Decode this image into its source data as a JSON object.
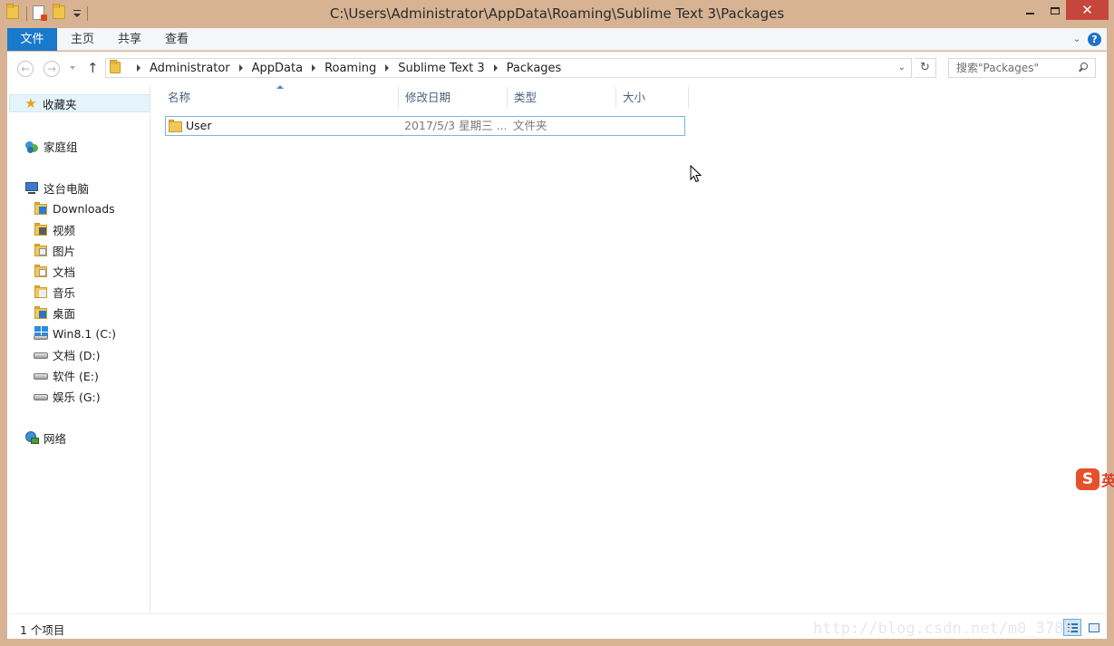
{
  "window": {
    "title": "C:\\Users\\Administrator\\AppData\\Roaming\\Sublime Text 3\\Packages",
    "close_glyph": "✕"
  },
  "ribbon": {
    "tabs": [
      "文件",
      "主页",
      "共享",
      "查看"
    ],
    "help_glyph": "?",
    "expand_glyph": "⌄"
  },
  "address": {
    "crumbs": [
      "Administrator",
      "AppData",
      "Roaming",
      "Sublime Text 3",
      "Packages"
    ],
    "search_placeholder": "搜索\"Packages\"",
    "back_glyph": "←",
    "forward_glyph": "→",
    "up_glyph": "↑",
    "refresh_glyph": "↻",
    "dropdown_glyph": "⌄"
  },
  "nav": {
    "favorites": "收藏夹",
    "homegroup": "家庭组",
    "this_pc": "这台电脑",
    "items": [
      {
        "label": "Downloads",
        "icon": "downloads-folder-icon"
      },
      {
        "label": "视频",
        "icon": "videos-folder-icon"
      },
      {
        "label": "图片",
        "icon": "pictures-folder-icon"
      },
      {
        "label": "文档",
        "icon": "documents-folder-icon"
      },
      {
        "label": "音乐",
        "icon": "music-folder-icon"
      },
      {
        "label": "桌面",
        "icon": "desktop-folder-icon"
      }
    ],
    "drives": [
      {
        "label": "Win8.1 (C:)",
        "icon": "system-drive-icon"
      },
      {
        "label": "文档 (D:)",
        "icon": "drive-icon"
      },
      {
        "label": "软件 (E:)",
        "icon": "drive-icon"
      },
      {
        "label": "娱乐 (G:)",
        "icon": "drive-icon"
      }
    ],
    "network": "网络"
  },
  "files": {
    "columns": [
      "名称",
      "修改日期",
      "类型",
      "大小"
    ],
    "rows": [
      {
        "name": "User",
        "date": "2017/5/3 星期三 ...",
        "type": "文件夹",
        "size": ""
      }
    ]
  },
  "status": {
    "count": "1 个项目"
  },
  "watermark": "http://blog.csdn.net/m0_3789",
  "ime": {
    "logo": "S",
    "mode": "英"
  },
  "colors": {
    "frame": "#d7b394",
    "file_tab": "#1979ca",
    "close_button": "#c7463c",
    "selection_border": "#7bb3e0"
  }
}
